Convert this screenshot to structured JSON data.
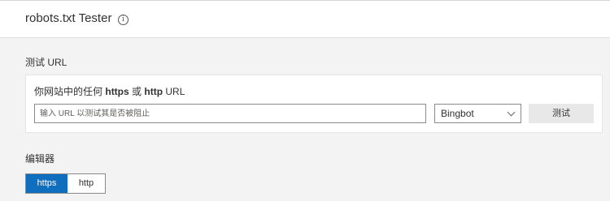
{
  "header": {
    "title": "robots.txt Tester",
    "info_icon": "info-icon"
  },
  "test_section": {
    "label": "测试 URL",
    "card": {
      "label_prefix": "你网站中的任何",
      "label_https": "https",
      "label_or": "或",
      "label_http": "http",
      "label_suffix": "URL",
      "url_placeholder": "输入 URL 以测试其是否被阻止",
      "url_value": "",
      "bot_selected": "Bingbot",
      "test_button": "测试"
    }
  },
  "editor_section": {
    "label": "编辑器",
    "protocol_options": [
      "https",
      "http"
    ],
    "protocol_selected": "https"
  },
  "colors": {
    "accent": "#106ebe",
    "background": "#f3f3f3"
  }
}
